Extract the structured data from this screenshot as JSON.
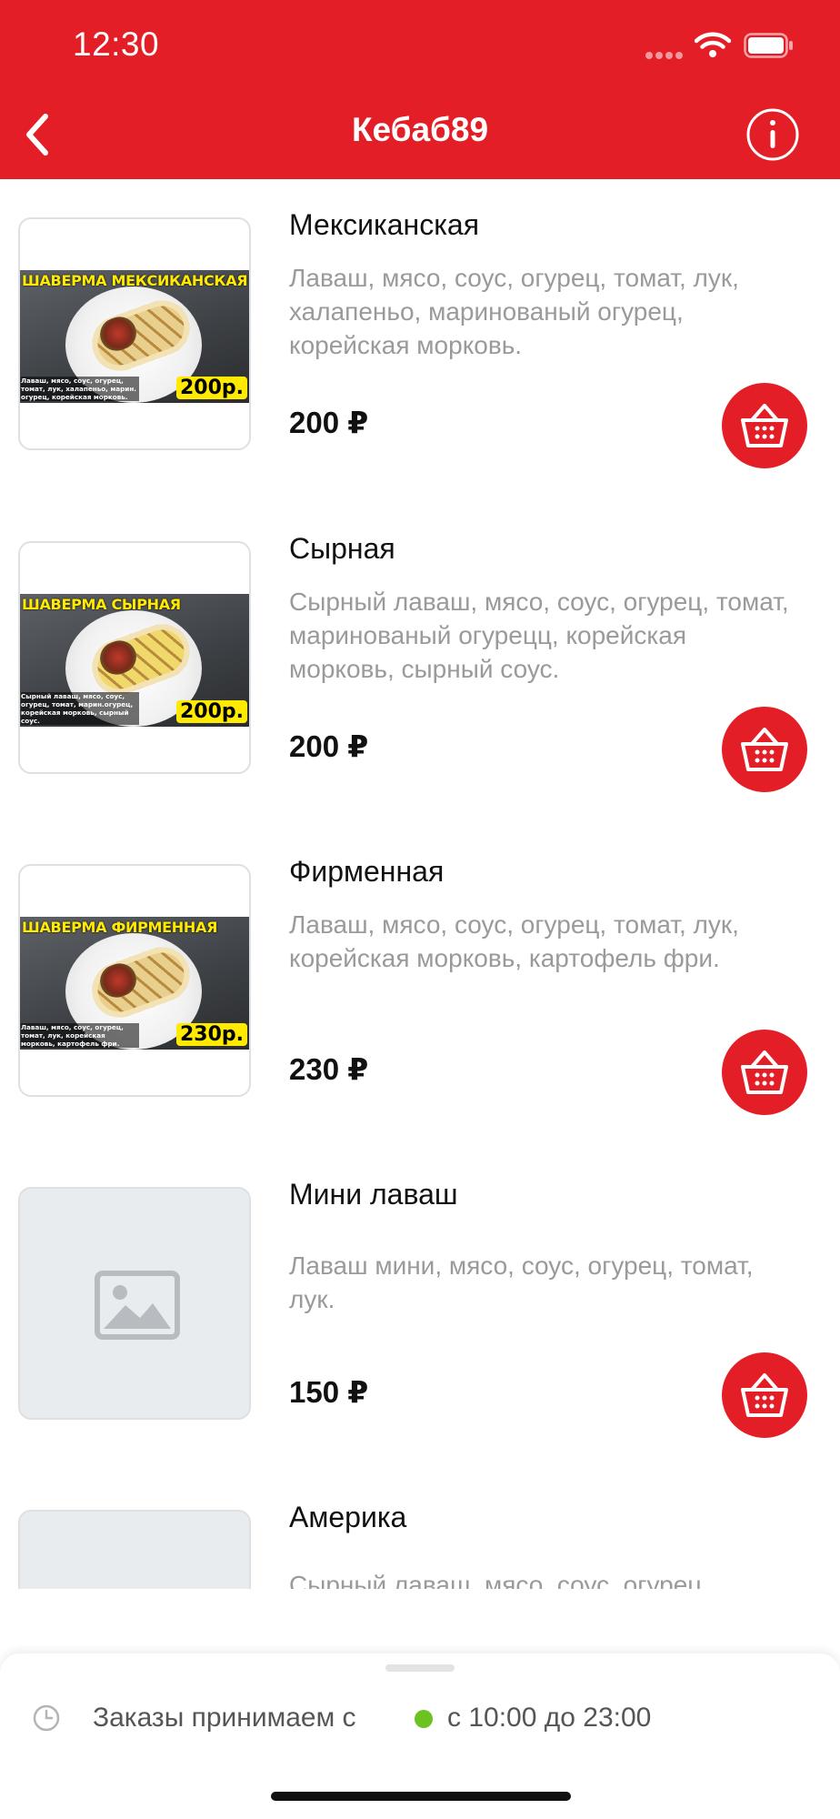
{
  "status_bar": {
    "time": "12:30"
  },
  "header": {
    "title": "Кебаб89"
  },
  "items": [
    {
      "name": "Мексиканская",
      "description": "Лаваш, мясо, соус, огурец, томат, лук, халапеньо, маринованый огурец, корейская морковь.",
      "price": "200 ₽",
      "image": {
        "type": "photo",
        "promo_title": "ШАВЕРМА МЕКСИКАНСКАЯ",
        "promo_desc": "Лаваш, мясо, соус, огурец, томат, лук, халапеньо, марин. огурец, корейская морковь.",
        "promo_price": "200р."
      }
    },
    {
      "name": "Сырная",
      "description": "Сырный лаваш, мясо, соус, огурец, томат, маринованый огурецц, корейская морковь, сырный соус.",
      "price": "200 ₽",
      "image": {
        "type": "photo",
        "promo_title": "ШАВЕРМА СЫРНАЯ",
        "promo_desc": "Сырный лаваш, мясо, соус, огурец, томат, марин.огурец, корейская морковь, сырный соус.",
        "promo_price": "200р."
      }
    },
    {
      "name": "Фирменная",
      "description": "Лаваш, мясо, соус, огурец, томат, лук, корейская морковь, картофель фри.",
      "price": "230 ₽",
      "image": {
        "type": "photo",
        "promo_title": "ШАВЕРМА ФИРМЕННАЯ",
        "promo_desc": "Лаваш, мясо, соус, огурец, томат, лук, корейская морковь, картофель фри.",
        "promo_price": "230р."
      }
    },
    {
      "name": "Мини лаваш",
      "description": "Лаваш мини, мясо, соус, огурец, томат, лук.",
      "price": "150 ₽",
      "image": {
        "type": "placeholder"
      }
    },
    {
      "name": "Америка",
      "description": "Сырный лаваш, мясо, соус, огурец",
      "price": "",
      "image": {
        "type": "placeholder"
      }
    }
  ],
  "footer": {
    "hours_label": "Заказы принимаем с",
    "hours_range": "с 10:00 до 23:00",
    "open_status_color": "#6cc21e"
  },
  "colors": {
    "brand": "#e41e26",
    "muted_text": "#9a9a9a"
  },
  "icons": {
    "back": "chevron-left-icon",
    "info": "info-icon",
    "cart": "basket-icon",
    "clock": "clock-icon",
    "image_placeholder": "image-placeholder-icon"
  }
}
